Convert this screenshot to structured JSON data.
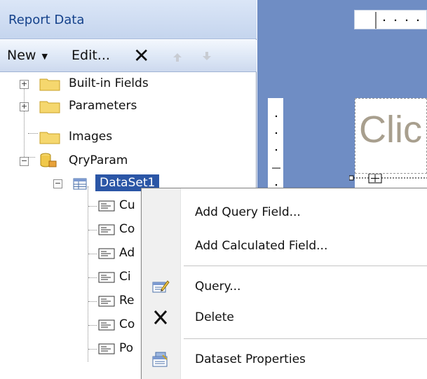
{
  "panel": {
    "title": "Report Data"
  },
  "toolbar": {
    "new_label": "New",
    "edit_label": "Edit...",
    "delete_glyph": "✕"
  },
  "tree": {
    "items": [
      {
        "label": "Built-in Fields",
        "icon": "folder-icon",
        "expander": "+"
      },
      {
        "label": "Parameters",
        "icon": "folder-icon",
        "expander": "+"
      },
      {
        "label": "Images",
        "icon": "folder-icon"
      },
      {
        "label": "QryParam",
        "icon": "datasource-icon",
        "expander": "−"
      },
      {
        "label": "DataSet1",
        "icon": "dataset-icon",
        "expander": "−",
        "selected": true
      }
    ],
    "fields": [
      "Cu",
      "Co",
      "Ad",
      "Ci",
      "Re",
      "Co",
      "Po"
    ]
  },
  "designer": {
    "title_text": "Clic"
  },
  "context_menu": {
    "items": [
      {
        "label": "Add Query Field...",
        "icon": null
      },
      {
        "label": "Add Calculated Field...",
        "icon": null
      },
      {
        "label": "Query...",
        "icon": "query-edit-icon"
      },
      {
        "label": "Delete",
        "icon": "delete-icon"
      },
      {
        "label": "Dataset Properties",
        "icon": "properties-icon"
      }
    ]
  },
  "colors": {
    "selection": "#2b56a6",
    "header_text": "#15428b",
    "designer_bg": "#6f8dc4"
  }
}
